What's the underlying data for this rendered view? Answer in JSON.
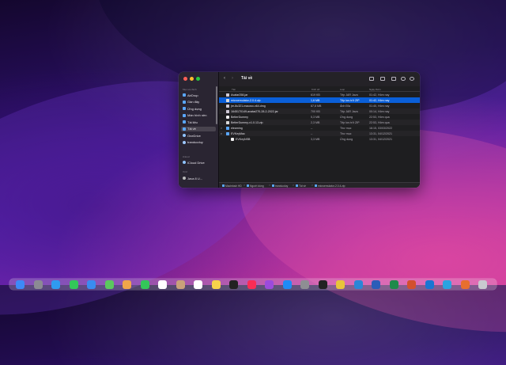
{
  "window": {
    "title": "Tải về",
    "sidebar": {
      "favorites_header": "Mục ưa thích",
      "items": [
        {
          "label": "AirDrop",
          "icon": "airdrop-icon",
          "selected": false
        },
        {
          "label": "Gần đây",
          "icon": "clock-icon",
          "selected": false
        },
        {
          "label": "Ứng dụng",
          "icon": "apps-icon",
          "selected": false
        },
        {
          "label": "Màn hình nền",
          "icon": "desktop-icon",
          "selected": false
        },
        {
          "label": "Tài liệu",
          "icon": "document-icon",
          "selected": false
        },
        {
          "label": "Tải về",
          "icon": "download-icon",
          "selected": true
        },
        {
          "label": "OneDrive",
          "icon": "cloud-icon",
          "selected": false
        },
        {
          "label": "tranducduy",
          "icon": "home-icon",
          "selected": false
        }
      ],
      "icloud_header": "iCloud",
      "icloud_items": [
        {
          "label": "iCloud Drive",
          "icon": "cloud-icon"
        }
      ],
      "locations_header": "Vị trí",
      "location_items": [
        {
          "label": "Java 8 U...",
          "icon": "disk-icon"
        }
      ]
    },
    "columns": {
      "name": "Tên",
      "size": "Kích cỡ",
      "kind": "Loại",
      "date": "Ngày thêm"
    },
    "rows": [
      {
        "name": "Avatar258.jar",
        "size": "619 KB",
        "kind": "Tệp JAR Java",
        "date": "01:42, Hôm nay",
        "type": "file",
        "selected": false,
        "disclosure": ""
      },
      {
        "name": "microemulator-2.0.4.zip",
        "size": "1,6 MB",
        "kind": "Tệp lưu trữ ZIP",
        "date": "01:42, Hôm nay",
        "type": "zip",
        "selected": true,
        "disclosure": ""
      },
      {
        "name": "jre-8u321-macosx-x64.dmg",
        "size": "87,8 MB",
        "kind": "Ảnh Đĩa",
        "date": "01:40, Hôm nay",
        "type": "file",
        "selected": false,
        "disclosure": ""
      },
      {
        "name": "1645170149-avatar270-28-2-2022.jar",
        "size": "700 KB",
        "kind": "Tệp JAR Java",
        "date": "00:14, Hôm nay",
        "type": "file",
        "selected": false,
        "disclosure": ""
      },
      {
        "name": "BetterDummy",
        "size": "5,3 MB",
        "kind": "Ứng dụng",
        "date": "22:53, Hôm qua",
        "type": "app",
        "selected": false,
        "disclosure": ""
      },
      {
        "name": "BetterDummy-v1.0.13.zip",
        "size": "2,3 MB",
        "kind": "Tệp lưu trữ ZIP",
        "date": "22:53, Hôm qua",
        "type": "zip",
        "selected": false,
        "disclosure": ""
      },
      {
        "name": "elearning",
        "size": "--",
        "kind": "Thư mục",
        "date": "16:15, 03/03/2022",
        "type": "folder",
        "selected": false,
        "disclosure": ">"
      },
      {
        "name": "EVKeyMac",
        "size": "--",
        "kind": "Thư mục",
        "date": "13:31, 04/12/2021",
        "type": "folder",
        "selected": false,
        "disclosure": "v"
      },
      {
        "name": "EVKeyNSB",
        "size": "3,3 MB",
        "kind": "Ứng dụng",
        "date": "13:31, 04/12/2021",
        "type": "app",
        "selected": false,
        "disclosure": "",
        "indent": true
      }
    ],
    "pathbar": [
      {
        "label": "Macintosh HD"
      },
      {
        "label": "Người dùng"
      },
      {
        "label": "tranducduy"
      },
      {
        "label": "Tải về"
      },
      {
        "label": "microemulator-2.0.4.zip"
      }
    ],
    "pathbar_separator": ">"
  },
  "toolbar": {
    "back": "‹",
    "forward": "›",
    "search": "⌕"
  },
  "dock": {
    "icons": [
      "finder-icon",
      "launchpad-icon",
      "safari-icon",
      "messages-icon",
      "mail-icon",
      "maps-icon",
      "photos-icon",
      "facetime-icon",
      "calendar-icon",
      "contacts-icon",
      "reminders-icon",
      "notes-icon",
      "tv-icon",
      "music-icon",
      "podcasts-icon",
      "appstore-icon",
      "settings-icon",
      "terminal-icon",
      "chrome-icon",
      "vscode-icon",
      "word-icon",
      "excel-icon",
      "powerpoint-icon",
      "zalo-icon",
      "telegram-icon",
      "java-icon",
      "trash-icon"
    ],
    "colors": [
      "#3d8af7",
      "#8b8b93",
      "#2f9bf0",
      "#33c759",
      "#3a8cf0",
      "#5bc85e",
      "#f0a64a",
      "#34c759",
      "#ffffff",
      "#c9a27a",
      "#ffffff",
      "#f7d34a",
      "#222222",
      "#fa2d55",
      "#9b4bdc",
      "#1f8bf5",
      "#8e8e93",
      "#222222",
      "#e8c53a",
      "#2b86d6",
      "#2b5db8",
      "#1e8a4a",
      "#d2502e",
      "#1976d2",
      "#2aa3e0",
      "#e76f2f",
      "#c9c9cf"
    ]
  }
}
